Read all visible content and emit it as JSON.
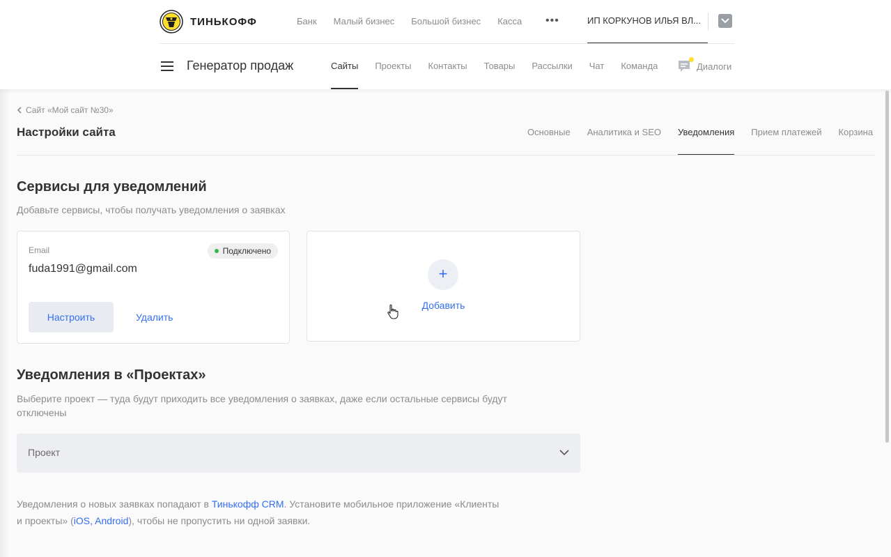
{
  "brand": {
    "name": "ТИНЬКОФФ"
  },
  "global_nav": [
    "Банк",
    "Малый бизнес",
    "Большой бизнес",
    "Касса"
  ],
  "account": {
    "name": "ИП КОРКУНОВ ИЛЬЯ ВЛ..."
  },
  "product": {
    "title": "Генератор продаж",
    "nav": [
      "Сайты",
      "Проекты",
      "Контакты",
      "Товары",
      "Рассылки",
      "Чат",
      "Команда"
    ],
    "active_nav": "Сайты",
    "dialogs_label": "Диалоги"
  },
  "breadcrumb": {
    "label": "Сайт «Мой сайт №30»"
  },
  "page": {
    "title": "Настройки сайта",
    "tabs": [
      "Основные",
      "Аналитика и SEO",
      "Уведомления",
      "Прием платежей",
      "Корзина"
    ],
    "active_tab": "Уведомления"
  },
  "services": {
    "title": "Сервисы для уведомлений",
    "subtitle": "Добавьте сервисы, чтобы получать уведомления о заявках",
    "email_card": {
      "label": "Email",
      "status": "Подключено",
      "value": "fuda1991@gmail.com",
      "configure_label": "Настроить",
      "delete_label": "Удалить"
    },
    "add_card": {
      "plus": "+",
      "label": "Добавить"
    }
  },
  "projects": {
    "title": "Уведомления в «Проектах»",
    "subtitle_line1": "Выберите проект — туда будут приходить все уведомления о заявках, даже если остальные сервисы будут",
    "subtitle_line2": "отключены",
    "select_placeholder": "Проект"
  },
  "info": {
    "part1": "Уведомления о новых заявках попадают в ",
    "crm_link": "Тинькофф CRM",
    "part2": ". Установите мобильное приложение «Клиенты",
    "part3": "и проекты» (",
    "ios_link": "iOS",
    "sep": ", ",
    "android_link": "Android",
    "part4": "), чтобы не пропустить ни одной заявки."
  },
  "colors": {
    "accent": "#336fee",
    "status_green": "#3ab54a",
    "notification_dot": "#ffdd2d",
    "text_primary": "#333333",
    "text_secondary": "#8c8c8c"
  },
  "icons": [
    "tinkoff-emblem-icon",
    "more-dots-icon",
    "chevron-down-icon",
    "burger-menu-icon",
    "dialogs-chat-icon",
    "chevron-left-icon",
    "plus-icon",
    "hand-cursor-icon"
  ]
}
